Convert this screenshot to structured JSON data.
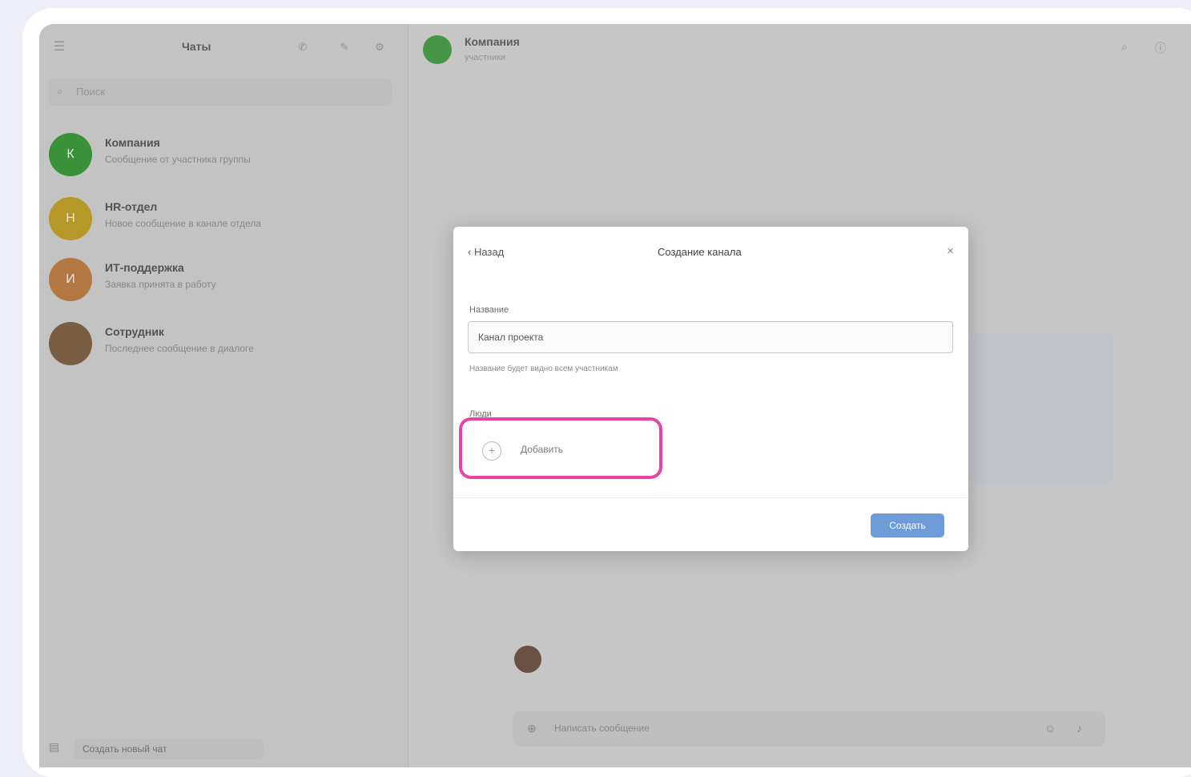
{
  "sidebar": {
    "title": "Чаты",
    "search_placeholder": "Поиск",
    "chats": [
      {
        "name": "Компания",
        "preview": "Сообщение от участника группы",
        "time": "",
        "avatar_color": "#2e9a2e",
        "avatar_letter": "К"
      },
      {
        "name": "HR-отдел",
        "preview": "Новое сообщение в канале отдела",
        "time": "",
        "avatar_color": "#c9a21a",
        "avatar_letter": "H"
      },
      {
        "name": "ИТ-поддержка",
        "preview": "Заявка принята в работу",
        "time": "",
        "avatar_color": "#c47a3a",
        "avatar_letter": "И"
      },
      {
        "name": "Сотрудник",
        "preview": "Последнее сообщение в диалоге",
        "time": "",
        "avatar_color": "#7a5a3a",
        "avatar_letter": ""
      }
    ],
    "bottom_button": "Создать новый чат"
  },
  "header": {
    "name": "Компания",
    "status": "участники"
  },
  "composer": {
    "placeholder": "Написать сообщение"
  },
  "modal": {
    "back_label": "Назад",
    "title": "Создание канала",
    "field_label": "Название",
    "field_value": "Канал проекта",
    "hint": "Название будет видно всем участникам",
    "section_label": "Люди",
    "add_label": "Добавить",
    "create_label": "Создать"
  },
  "colors": {
    "highlight": "#e645a8",
    "primary_button": "#6e9cd9"
  }
}
